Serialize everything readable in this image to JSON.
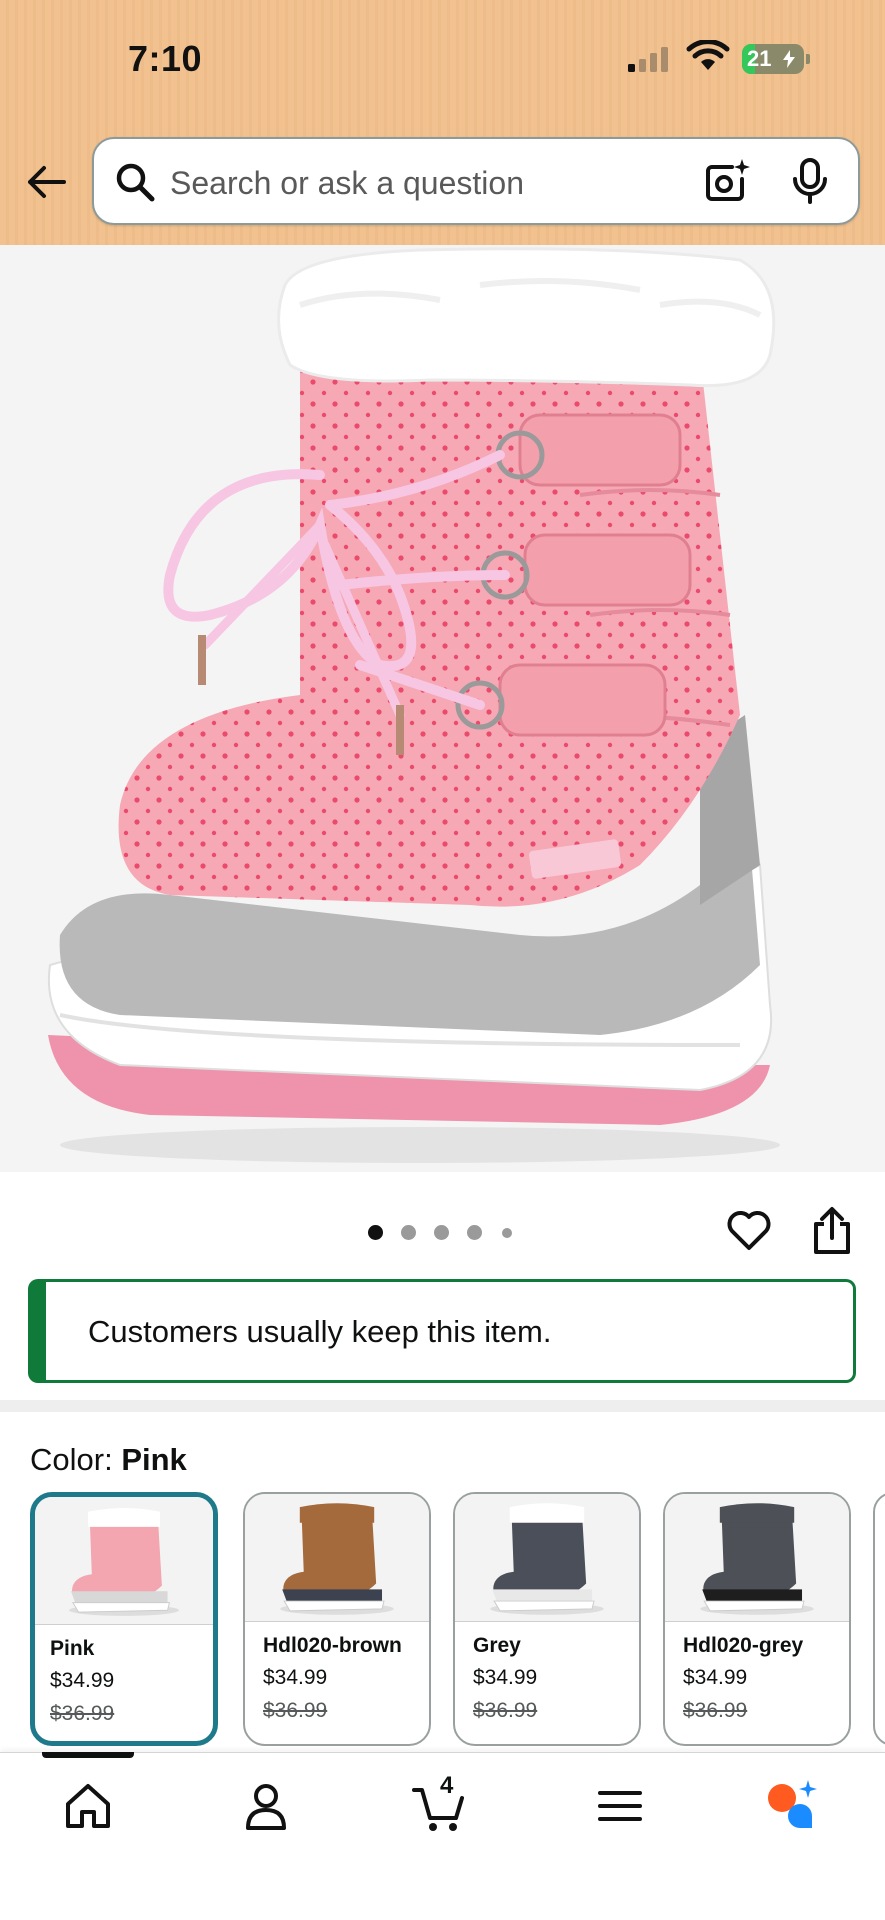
{
  "status_bar": {
    "time": "7:10",
    "battery": "21",
    "battery_level": 0.21
  },
  "search": {
    "placeholder": "Search or ask a question"
  },
  "carousel": {
    "image_count": 5,
    "active_index": 0
  },
  "banner": {
    "text": "Customers usually keep this item."
  },
  "color": {
    "label": "Color:",
    "selected": "Pink",
    "options": [
      {
        "name": "Pink",
        "price": "$34.99",
        "list_price": "$36.99",
        "boot_color": "#f3a5b0",
        "accent": "#d8d8d8"
      },
      {
        "name": "Hdl020-brown",
        "price": "$34.99",
        "list_price": "$36.99",
        "boot_color": "#a56a3c",
        "accent": "#3c4250"
      },
      {
        "name": "Grey",
        "price": "$34.99",
        "list_price": "$36.99",
        "boot_color": "#4a4f5a",
        "accent": "#e8e8e8"
      },
      {
        "name": "Hdl020-grey",
        "price": "$34.99",
        "list_price": "$36.99",
        "boot_color": "#4d5157",
        "accent": "#1e1e1e"
      }
    ]
  },
  "bottom_nav": {
    "items": [
      {
        "icon": "home-icon"
      },
      {
        "icon": "account-icon"
      },
      {
        "icon": "cart-icon",
        "count": "4"
      },
      {
        "icon": "menu-icon"
      },
      {
        "icon": "rufus-assistant-icon"
      }
    ]
  },
  "colors": {
    "header_bg": "#f1c28f",
    "banner_green": "#0f7a3a",
    "selected_border": "#1e7a8a",
    "assistant_orange": "#ff5a1f",
    "assistant_blue": "#1a8cff"
  }
}
